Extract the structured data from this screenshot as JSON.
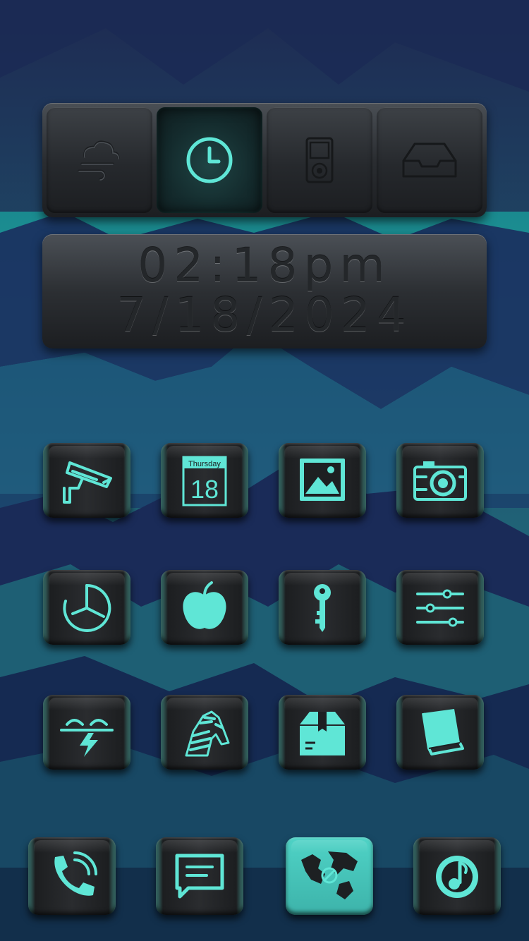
{
  "clock": {
    "time": "02:18pm",
    "date": "7/18/2024"
  },
  "widget_tabs": [
    {
      "icon": "weather-wind-icon",
      "active": false
    },
    {
      "icon": "clock-icon",
      "active": true
    },
    {
      "icon": "ipod-icon",
      "active": false
    },
    {
      "icon": "inbox-tray-icon",
      "active": false
    }
  ],
  "calendar_icon": {
    "weekday": "Thursday",
    "day": "18"
  },
  "apps": [
    {
      "row": 1,
      "icon": "security-camera-icon"
    },
    {
      "row": 1,
      "icon": "calendar-icon"
    },
    {
      "row": 1,
      "icon": "photos-icon"
    },
    {
      "row": 1,
      "icon": "camera-icon"
    },
    {
      "row": 2,
      "icon": "clock-app-icon"
    },
    {
      "row": 2,
      "icon": "apple-icon"
    },
    {
      "row": 2,
      "icon": "key-icon"
    },
    {
      "row": 2,
      "icon": "settings-sliders-icon"
    },
    {
      "row": 3,
      "icon": "power-line-icon"
    },
    {
      "row": 3,
      "icon": "zebra-icon"
    },
    {
      "row": 3,
      "icon": "package-box-icon"
    },
    {
      "row": 3,
      "icon": "book-icon"
    },
    {
      "row": "dock",
      "icon": "phone-icon"
    },
    {
      "row": "dock",
      "icon": "messages-icon"
    },
    {
      "row": "dock",
      "icon": "globe-map-icon"
    },
    {
      "row": "dock",
      "icon": "music-icon"
    }
  ],
  "colors": {
    "accent": "#5fe6d6",
    "panel": "#2a2d31",
    "background_top": "#1e6f78",
    "background_dark": "#16244a"
  }
}
